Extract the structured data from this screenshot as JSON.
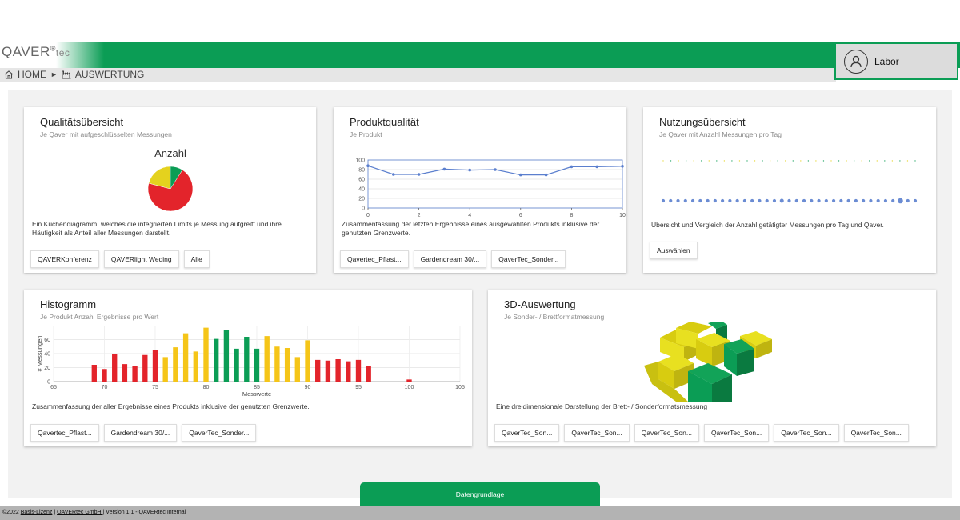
{
  "brand": {
    "logo_main": "QAVER",
    "logo_reg": "®",
    "logo_tec": "tec",
    "primary_color": "#0b9d55",
    "accent_blue": "#5b7fce"
  },
  "breadcrumb": {
    "home": "HOME",
    "separator": "►",
    "current": "AUSWERTUNG"
  },
  "user": {
    "name": "Labor"
  },
  "cards": {
    "quality": {
      "title": "Qualitätsübersicht",
      "subtitle": "Je Qaver mit aufgeschlüsselten Messungen",
      "description": "Ein Kuchendiagramm, welches die integrierten Limits je Messung aufgreift und ihre Häufigkeit als Anteil aller Messungen darstellt.",
      "buttons": [
        "QAVERKonferenz",
        "QAVERlight Weding",
        "Alle"
      ]
    },
    "product": {
      "title": "Produktqualität",
      "subtitle": "Je Produkt",
      "description": "Zusammenfassung der letzten Ergebnisse eines ausgewählten Produkts inklusive der genutzten Grenzwerte.",
      "buttons": [
        "Qavertec_Pflast...",
        "Gardendream 30/...",
        "QaverTec_Sonder..."
      ]
    },
    "usage": {
      "title": "Nutzungsübersicht",
      "subtitle": "Je Qaver mit Anzahl Messungen pro Tag",
      "description": "Übersicht und Vergleich der Anzahl getätigter Messungen pro Tag und Qaver.",
      "buttons": [
        "Auswählen"
      ]
    },
    "histogram": {
      "title": "Histogramm",
      "subtitle": "Je Produkt Anzahl Ergebnisse pro Wert",
      "description": "Zusammenfassung der aller Ergebnisse eines Produkts inklusive der genutzten Grenzwerte.",
      "buttons": [
        "Qavertec_Pflast...",
        "Gardendream 30/...",
        "QaverTec_Sonder..."
      ]
    },
    "threed": {
      "title": "3D-Auswertung",
      "subtitle": "Je Sonder- / Brettformatmessung",
      "description": "Eine dreidimensionale Darstellung der Brett- / Sonderformatsmessung",
      "buttons": [
        "QaverTec_Son...",
        "QaverTec_Son...",
        "QaverTec_Son...",
        "QaverTec_Son...",
        "QaverTec_Son...",
        "QaverTec_Son..."
      ]
    }
  },
  "datenbutton": "Datengrundlage",
  "footer": {
    "prefix": "©2022 ",
    "license_link": "Basis-Lizenz",
    "sep1": " | ",
    "company_link": "QAVERtec GmbH ",
    "suffix": "| Version 1.1 - QAVERtec Internal"
  },
  "chart_data": [
    {
      "type": "pie",
      "title": "Anzahl",
      "slices": [
        {
          "value": 70,
          "color": "#e3242b"
        },
        {
          "value": 21,
          "color": "#e4d21e"
        },
        {
          "value": 9,
          "color": "#0b9d55"
        }
      ]
    },
    {
      "type": "line",
      "x": [
        0,
        1,
        2,
        3,
        4,
        5,
        6,
        7,
        8,
        9,
        10
      ],
      "series": [
        {
          "values": [
            88,
            70,
            70,
            81,
            79,
            80,
            69,
            69,
            86,
            86,
            87
          ],
          "color": "#5b7fce"
        }
      ],
      "xlim": [
        0,
        10
      ],
      "ylim": [
        0,
        100
      ],
      "xticks": [
        0,
        2,
        4,
        6,
        8,
        10
      ],
      "yticks": [
        0,
        20,
        40,
        60,
        80,
        100
      ]
    },
    {
      "type": "scatter",
      "series": [
        {
          "values": [
            1,
            1,
            1,
            1,
            1,
            1,
            1,
            1,
            1,
            1,
            1,
            1,
            1,
            1,
            1,
            1,
            1,
            1,
            1,
            1,
            1,
            1,
            1,
            1,
            1,
            1,
            1,
            1,
            1,
            1,
            1,
            1,
            1,
            1
          ]
        },
        {
          "values": [
            3,
            3,
            3,
            3,
            3,
            3,
            3,
            3,
            3,
            3,
            3,
            3,
            3,
            3,
            3,
            3,
            4,
            3,
            3,
            3,
            3,
            3,
            3,
            3,
            3,
            3,
            3,
            3,
            3,
            3,
            3,
            3,
            6,
            3,
            3
          ]
        }
      ],
      "colors": [
        "#e4d21e",
        "#0b9d55",
        "#5b7fce"
      ]
    },
    {
      "type": "bar",
      "xlabel": "Messwerte",
      "ylabel": "# Messungen",
      "xlim": [
        65,
        105
      ],
      "ylim": [
        0,
        80
      ],
      "xticks": [
        65,
        70,
        75,
        80,
        85,
        90,
        95,
        100,
        105
      ],
      "yticks": [
        0,
        20,
        40,
        60
      ],
      "bars": [
        {
          "x": 69,
          "y": 24,
          "color": "#e3242b"
        },
        {
          "x": 70,
          "y": 18,
          "color": "#e3242b"
        },
        {
          "x": 71,
          "y": 39,
          "color": "#e3242b"
        },
        {
          "x": 72,
          "y": 25,
          "color": "#e3242b"
        },
        {
          "x": 73,
          "y": 22,
          "color": "#e3242b"
        },
        {
          "x": 74,
          "y": 38,
          "color": "#e3242b"
        },
        {
          "x": 75,
          "y": 45,
          "color": "#e3242b"
        },
        {
          "x": 76,
          "y": 35,
          "color": "#f5c518"
        },
        {
          "x": 77,
          "y": 49,
          "color": "#f5c518"
        },
        {
          "x": 78,
          "y": 69,
          "color": "#f5c518"
        },
        {
          "x": 79,
          "y": 43,
          "color": "#f5c518"
        },
        {
          "x": 80,
          "y": 77,
          "color": "#f5c518"
        },
        {
          "x": 81,
          "y": 61,
          "color": "#0b9d55"
        },
        {
          "x": 82,
          "y": 74,
          "color": "#0b9d55"
        },
        {
          "x": 83,
          "y": 47,
          "color": "#0b9d55"
        },
        {
          "x": 84,
          "y": 64,
          "color": "#0b9d55"
        },
        {
          "x": 85,
          "y": 47,
          "color": "#0b9d55"
        },
        {
          "x": 86,
          "y": 65,
          "color": "#f5c518"
        },
        {
          "x": 87,
          "y": 50,
          "color": "#f5c518"
        },
        {
          "x": 88,
          "y": 48,
          "color": "#f5c518"
        },
        {
          "x": 89,
          "y": 35,
          "color": "#f5c518"
        },
        {
          "x": 90,
          "y": 59,
          "color": "#f5c518"
        },
        {
          "x": 91,
          "y": 31,
          "color": "#e3242b"
        },
        {
          "x": 92,
          "y": 30,
          "color": "#e3242b"
        },
        {
          "x": 93,
          "y": 32,
          "color": "#e3242b"
        },
        {
          "x": 94,
          "y": 29,
          "color": "#e3242b"
        },
        {
          "x": 95,
          "y": 31,
          "color": "#e3242b"
        },
        {
          "x": 96,
          "y": 22,
          "color": "#e3242b"
        },
        {
          "x": 100,
          "y": 3,
          "color": "#e3242b"
        }
      ]
    }
  ]
}
